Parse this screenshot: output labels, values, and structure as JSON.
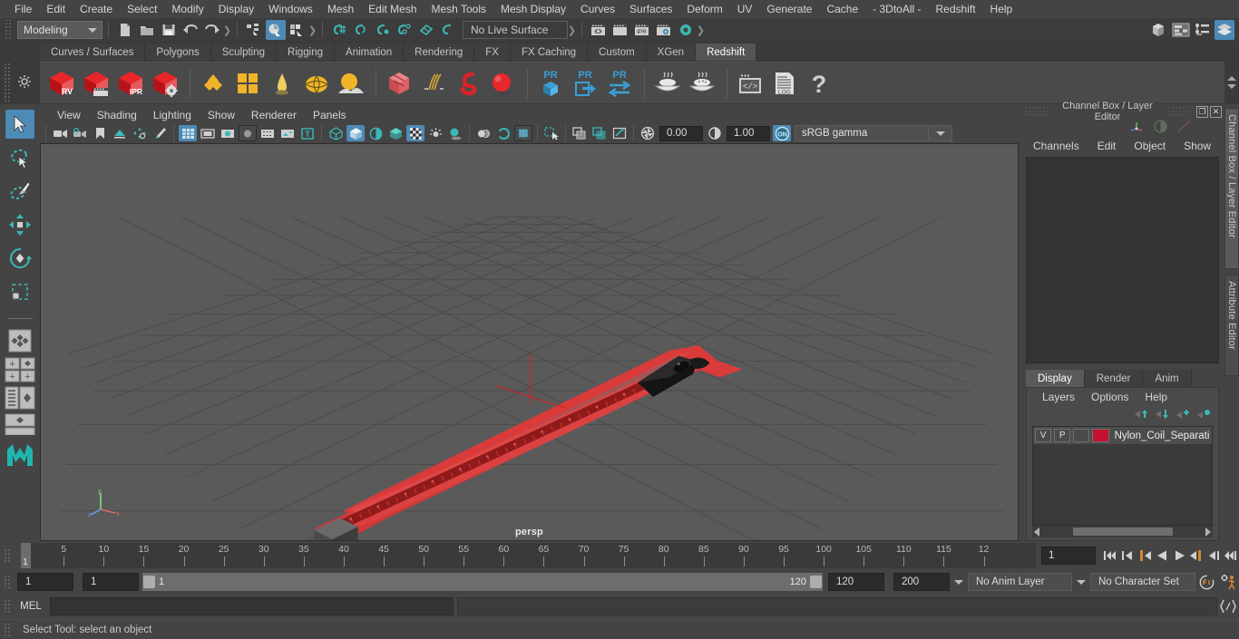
{
  "menubar": {
    "items": [
      "File",
      "Edit",
      "Create",
      "Select",
      "Modify",
      "Display",
      "Windows",
      "Mesh",
      "Edit Mesh",
      "Mesh Tools",
      "Mesh Display",
      "Curves",
      "Surfaces",
      "Deform",
      "UV",
      "Generate",
      "Cache",
      "- 3DtoAll -",
      "Redshift",
      "Help"
    ]
  },
  "statusline": {
    "mode": "Modeling",
    "live_surface": "No Live Surface",
    "icons": [
      "new-scene-icon",
      "open-scene-icon",
      "save-scene-icon",
      "undo-icon",
      "redo-icon",
      "select-hierarchy-icon",
      "select-object-icon",
      "select-component-icon",
      "snap-grid-icon",
      "snap-curve-icon",
      "snap-point-icon",
      "snap-projected-center-icon",
      "snap-view-plane-icon",
      "make-live-icon",
      "show-render-view-icon",
      "render-icon",
      "ipr-render-icon",
      "render-settings-icon",
      "hypershade-icon"
    ],
    "right_icons": [
      "show-hide-modeling-toolkit-icon",
      "show-hide-attribute-editor-icon",
      "show-hide-tool-settings-icon",
      "show-hide-channel-box-icon"
    ]
  },
  "shelf": {
    "tabs": [
      "Curves / Surfaces",
      "Polygons",
      "Sculpting",
      "Rigging",
      "Animation",
      "Rendering",
      "FX",
      "FX Caching",
      "Custom",
      "XGen",
      "Redshift"
    ],
    "active_tab": "Redshift",
    "icons": [
      "redshift-render-view-icon",
      "redshift-render-sequence-icon",
      "redshift-ipr-icon",
      "redshift-render-settings-icon",
      "redshift-material-icon",
      "redshift-matte-icon",
      "redshift-incandescent-icon",
      "redshift-dome-light-icon",
      "redshift-environment-icon",
      "redshift-proxy-icon",
      "redshift-hair-icon",
      "redshift-volume-icon",
      "redshift-sphere-light-icon",
      "redshift-pr-point-cloud-icon",
      "redshift-pr-export-icon",
      "redshift-pr-transfer-icon",
      "redshift-bake-icon",
      "redshift-bake-all-icon",
      "redshift-script-icon",
      "redshift-log-icon",
      "redshift-help-icon"
    ]
  },
  "toolbox": {
    "items": [
      "select-tool",
      "lasso-select-tool",
      "paint-select-tool",
      "move-tool",
      "rotate-tool",
      "scale-tool",
      "last-tool-used",
      "four-view-layout",
      "persp-outliner-layout",
      "persp-graph-layout",
      "single-persp-layout",
      "maya-logo"
    ]
  },
  "viewport": {
    "menu": [
      "View",
      "Shading",
      "Lighting",
      "Show",
      "Renderer",
      "Panels"
    ],
    "camera_label": "persp",
    "exposure": "0.00",
    "gamma": "1.00",
    "view_transform": "sRGB gamma",
    "toolbar_icons": [
      "select-camera-icon",
      "camera-attributes-icon",
      "bookmark-icon",
      "image-plane-icon",
      "two-d-pan-zoom-icon",
      "grease-pencil-icon",
      "grid-icon",
      "film-gate-icon",
      "resolution-gate-icon",
      "gate-mask-icon",
      "film-origin-icon",
      "safe-action-icon",
      "text-overlay-icon",
      "wireframe-icon",
      "smooth-shade-all-icon",
      "shaded-wireframe-icon",
      "use-default-material-icon",
      "textured-icon",
      "use-all-lights-icon",
      "shadows-icon",
      "screen-space-ao-icon",
      "motion-blur-icon",
      "multisample-aa-icon",
      "depth-of-field-icon",
      "isolate-select-icon",
      "xray-icon",
      "xray-joints-icon",
      "xray-active-components-icon",
      "exposure-icon",
      "gamma-icon",
      "color-management-icon"
    ]
  },
  "channelbox": {
    "title": "Channel Box / Layer Editor",
    "menu": [
      "Channels",
      "Edit",
      "Object",
      "Show"
    ],
    "dock_buttons": [
      "undock-icon",
      "close-icon"
    ],
    "vertical_tabs": [
      "Channel Box / Layer Editor",
      "Attribute Editor"
    ]
  },
  "layer_editor": {
    "tabs": [
      "Display",
      "Render",
      "Anim"
    ],
    "active_tab": "Display",
    "menu": [
      "Layers",
      "Options",
      "Help"
    ],
    "buttons": [
      "move-layer-up-icon",
      "move-layer-down-icon",
      "create-new-layer-icon",
      "create-layer-from-selected-icon"
    ],
    "layers": [
      {
        "visibility": "V",
        "playback": "P",
        "shading": "",
        "color": "#c41230",
        "name": "Nylon_Coil_Separating"
      }
    ]
  },
  "timeline": {
    "tick_labels": [
      "5",
      "10",
      "15",
      "20",
      "25",
      "30",
      "35",
      "40",
      "45",
      "50",
      "55",
      "60",
      "65",
      "70",
      "75",
      "80",
      "85",
      "90",
      "95",
      "100",
      "105",
      "110",
      "115",
      "12"
    ],
    "current_frame_marker": "1",
    "current_frame": "1",
    "playback_buttons": [
      "go-to-start-icon",
      "step-back-keyframe-icon",
      "step-back-frame-icon",
      "play-backwards-icon",
      "play-forwards-icon",
      "step-forward-frame-icon",
      "step-forward-keyframe-icon",
      "go-to-end-icon"
    ]
  },
  "range": {
    "anim_start": "1",
    "range_start": "1",
    "slider_left_label": "1",
    "slider_right_label": "120",
    "range_end": "120",
    "anim_end": "200",
    "anim_layer": "No Anim Layer",
    "character_set": "No Character Set",
    "right_icons": [
      "auto-key-icon",
      "animation-preferences-icon"
    ]
  },
  "command_line": {
    "label": "MEL",
    "input_value": "",
    "output_value": "",
    "script-editor-icon": "script-editor-icon"
  },
  "helpline": {
    "text": "Select Tool: select an object"
  },
  "colors": {
    "accent": "#4d8ab5",
    "panel_bg": "#444444",
    "viewport_bg": "#5a5a5a",
    "model_red": "#d93b3b",
    "layer_red": "#c41230",
    "orange": "#d88531"
  }
}
